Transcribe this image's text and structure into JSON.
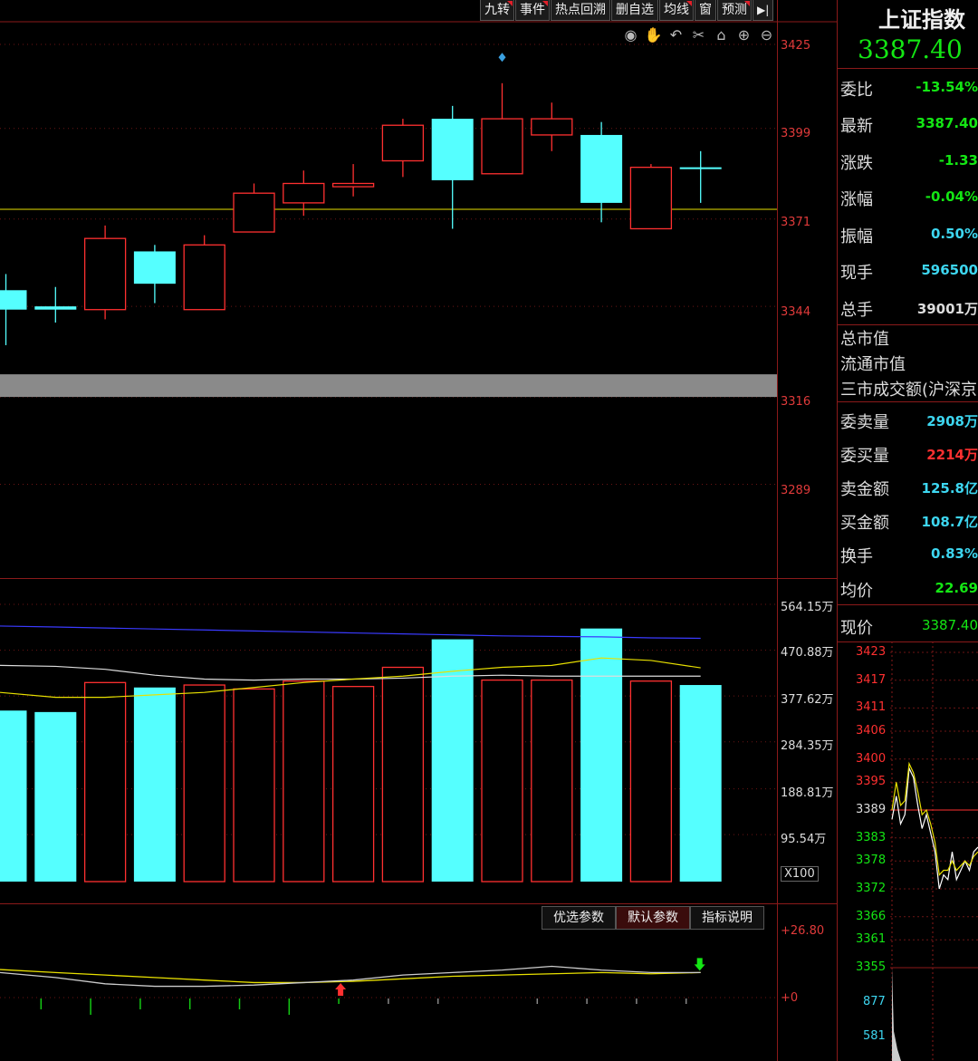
{
  "toolbar": {
    "buttons": [
      "九转",
      "事件",
      "热点回溯",
      "删自选",
      "均线",
      "窗",
      "预测"
    ],
    "marked": [
      true,
      true,
      false,
      false,
      true,
      false,
      true
    ],
    "arrow_icon": "arrow-right-bar-icon"
  },
  "chart_tools": [
    "eye-icon",
    "hand-icon",
    "undo-icon",
    "scissors-icon",
    "lock-icon",
    "zoom-in-icon",
    "zoom-out-icon"
  ],
  "chart_data": [
    {
      "type": "candlestick",
      "price_axis_ticks": [
        "3425",
        "3399",
        "3371",
        "3344",
        "3316",
        "3289"
      ],
      "ylim": [
        3260,
        3432
      ],
      "reference_line": 3374,
      "gray_band": [
        3316,
        3323
      ],
      "candles": [
        {
          "open": 3349,
          "close": 3343,
          "high": 3354,
          "low": 3332,
          "color": "cyan"
        },
        {
          "open": 3344,
          "close": 3343,
          "high": 3350,
          "low": 3339,
          "color": "cyan"
        },
        {
          "open": 3343,
          "close": 3365,
          "high": 3369,
          "low": 3340,
          "color": "red"
        },
        {
          "open": 3361,
          "close": 3351,
          "high": 3363,
          "low": 3345,
          "color": "cyan"
        },
        {
          "open": 3343,
          "close": 3363,
          "high": 3366,
          "low": 3343,
          "color": "red"
        },
        {
          "open": 3367,
          "close": 3379,
          "high": 3382,
          "low": 3367,
          "color": "red"
        },
        {
          "open": 3376,
          "close": 3382,
          "high": 3386,
          "low": 3372,
          "color": "red"
        },
        {
          "open": 3381,
          "close": 3382,
          "high": 3388,
          "low": 3378,
          "color": "red"
        },
        {
          "open": 3389,
          "close": 3400,
          "high": 3402,
          "low": 3384,
          "color": "red"
        },
        {
          "open": 3383,
          "close": 3402,
          "high": 3406,
          "low": 3368,
          "color": "cyan"
        },
        {
          "open": 3385,
          "close": 3402,
          "high": 3413,
          "low": 3385,
          "color": "red"
        },
        {
          "open": 3397,
          "close": 3402,
          "high": 3407,
          "low": 3392,
          "color": "red"
        },
        {
          "open": 3397,
          "close": 3376,
          "high": 3401,
          "low": 3370,
          "color": "cyan"
        },
        {
          "open": 3368,
          "close": 3387,
          "high": 3388,
          "low": 3368,
          "color": "red"
        },
        {
          "open": 3387,
          "close": 3387,
          "high": 3392,
          "low": 3376,
          "color": "cyan"
        }
      ],
      "marker": {
        "candle_index": 10,
        "price": 3421,
        "shape": "diamond"
      }
    },
    {
      "type": "bar",
      "unit_label": "X100",
      "volume_axis_ticks": [
        "564.15万",
        "470.88万",
        "377.62万",
        "284.35万",
        "188.81万",
        "95.54万"
      ],
      "ylim": [
        0,
        564.15
      ],
      "values": [
        348,
        345,
        405,
        395,
        400,
        392,
        408,
        397,
        436,
        493,
        410,
        410,
        515,
        408,
        400
      ],
      "colors": [
        "cyan",
        "cyan",
        "red",
        "cyan",
        "red",
        "red",
        "red",
        "red",
        "red",
        "cyan",
        "red",
        "red",
        "cyan",
        "red",
        "cyan"
      ],
      "series": [
        {
          "color": "#3a3aff",
          "values": [
            520,
            518,
            516,
            514,
            512,
            510,
            508,
            506,
            504,
            502,
            500,
            499,
            498,
            496,
            495
          ]
        },
        {
          "color": "#dddddd",
          "values": [
            440,
            438,
            432,
            420,
            412,
            410,
            412,
            412,
            414,
            418,
            420,
            418,
            418,
            418,
            418
          ]
        },
        {
          "color": "#e8e000",
          "values": [
            385,
            375,
            375,
            380,
            385,
            395,
            405,
            412,
            418,
            428,
            436,
            440,
            455,
            450,
            435
          ]
        }
      ]
    },
    {
      "type": "line",
      "axis_ticks": [
        "+26.80",
        "+0"
      ],
      "ylim": [
        0,
        26.8
      ],
      "series": [
        {
          "color": "#e8e000",
          "values": [
            11.2,
            10.0,
            9.0,
            8.0,
            7.0,
            6.0,
            6.0,
            6.5,
            7.5,
            8.5,
            9.0,
            9.5,
            10.0,
            9.5,
            10.0
          ]
        },
        {
          "color": "#cccccc",
          "values": [
            10.0,
            8.0,
            5.5,
            4.5,
            4.5,
            5.0,
            6.0,
            7.0,
            9.0,
            10.0,
            11.0,
            12.5,
            11.0,
            10.0,
            10.0
          ]
        }
      ],
      "buy_arrow_index": 7,
      "sell_arrow_index": 14,
      "tick_bars": [
        3,
        2,
        3,
        2,
        2,
        2,
        3,
        1,
        1,
        1,
        0,
        1,
        1,
        1,
        1
      ],
      "tick_colors": [
        "green",
        "green",
        "green",
        "green",
        "green",
        "green",
        "green",
        "green",
        "gray",
        "gray",
        "gray",
        "gray",
        "gray",
        "gray",
        "gray"
      ]
    },
    {
      "type": "line",
      "axis_ticks": [
        "3423",
        "3417",
        "3411",
        "3406",
        "3400",
        "3395",
        "3389",
        "3383",
        "3378",
        "3372",
        "3366",
        "3361",
        "3355"
      ],
      "ylim": [
        3355,
        3423
      ],
      "reference_value": 3389,
      "series": [
        {
          "color": "#ffffff",
          "values": [
            3387,
            3392,
            3386,
            3388,
            3398,
            3396,
            3390,
            3385,
            3388,
            3384,
            3380,
            3372,
            3375,
            3374,
            3380,
            3374,
            3376,
            3378,
            3376,
            3380,
            3381
          ]
        },
        {
          "color": "#e8e000",
          "values": [
            3389,
            3395,
            3390,
            3391,
            3399,
            3397,
            3393,
            3388,
            3389,
            3386,
            3382,
            3375,
            3376,
            3376,
            3378,
            3376,
            3377,
            3378,
            3377,
            3379,
            3380
          ]
        }
      ],
      "volume_ticks": [
        "877",
        "581"
      ]
    }
  ],
  "side": {
    "index_name": "上证指数",
    "price": "3387.40",
    "rows": [
      {
        "key": "委比",
        "value": "-13.54%",
        "color": "green"
      },
      {
        "key": "最新",
        "value": "3387.40",
        "color": "green"
      },
      {
        "key": "涨跌",
        "value": "-1.33",
        "color": "green"
      },
      {
        "key": "涨幅",
        "value": "-0.04%",
        "color": "green"
      },
      {
        "key": "振幅",
        "value": "0.50%",
        "color": "cyan"
      },
      {
        "key": "现手",
        "value": "596500",
        "color": "cyan"
      },
      {
        "key": "总手",
        "value": "39001万",
        "color": "white"
      }
    ],
    "plain_rows": [
      "总市值",
      "流通市值",
      "三市成交额(沪深京"
    ],
    "rows2": [
      {
        "key": "委卖量",
        "value": "2908万",
        "color": "cyan"
      },
      {
        "key": "委买量",
        "value": "2214万",
        "color": "red"
      },
      {
        "key": "卖金额",
        "value": "125.8亿",
        "color": "cyan"
      },
      {
        "key": "买金额",
        "value": "108.7亿",
        "color": "cyan"
      },
      {
        "key": "换手",
        "value": "0.83%",
        "color": "cyan"
      },
      {
        "key": "均价",
        "value": "22.69",
        "color": "green"
      },
      {
        "key": "现价",
        "value": "3387.40",
        "color": "green"
      }
    ]
  },
  "param_tabs": [
    "优选参数",
    "默认参数",
    "指标说明"
  ]
}
